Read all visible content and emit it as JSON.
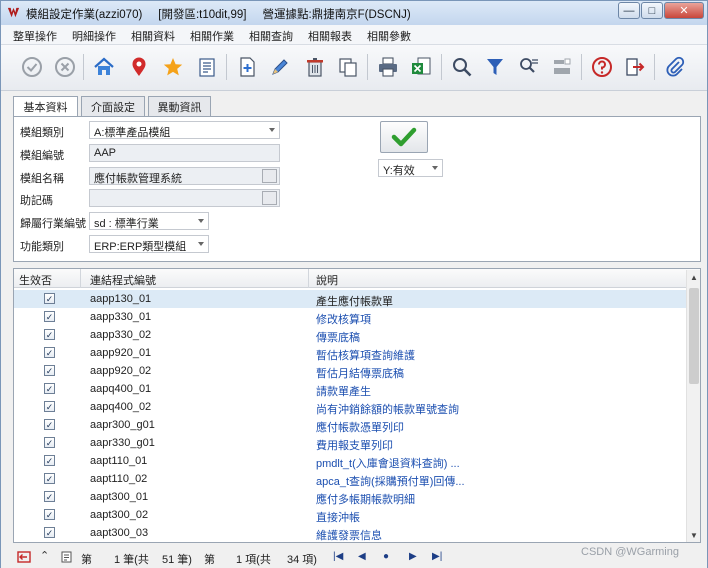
{
  "window": {
    "title": "模組設定作業(azzi070)     [開發區:t10dit,99]     營運據點:鼎捷南京F(DSCNJ)",
    "controls": [
      "—",
      "□",
      "✕"
    ]
  },
  "menu": [
    "整單操作",
    "明細操作",
    "相關資料",
    "相關作業",
    "相關查詢",
    "相關報表",
    "相關參數"
  ],
  "toolbar_icons": [
    "confirm-icon",
    "cancel-icon",
    "home-icon",
    "location-pin-icon",
    "star-icon",
    "list-icon",
    "add-icon",
    "edit-icon",
    "delete-icon",
    "copy-icon",
    "print-icon",
    "export-excel-icon",
    "search-icon",
    "filter-icon",
    "advanced-query-icon",
    "clear-icon",
    "help-icon",
    "exit-icon",
    "attachment-icon"
  ],
  "tabs": [
    "基本資料",
    "介面設定",
    "異動資訊"
  ],
  "form": {
    "category_label": "模組類別",
    "category_value": "A:標準產品模組",
    "module_no_label": "模組編號",
    "module_no_value": "AAP",
    "module_name_label": "模組名稱",
    "module_name_value": "應付帳款管理系統",
    "mnemonic_label": "助記碼",
    "mnemonic_value": "",
    "industry_label": "歸屬行業編號",
    "industry_value": "sd : 標準行業",
    "function_label": "功能類別",
    "function_value": "ERP:ERP類型模組",
    "status_value": "Y:有效"
  },
  "grid": {
    "columns": [
      "生效否",
      "連結程式編號",
      "說明"
    ],
    "rows": [
      {
        "program": "aapp130_01",
        "desc": "產生應付帳款單",
        "checked": true
      },
      {
        "program": "aapp330_01",
        "desc": "修改核算項",
        "checked": true
      },
      {
        "program": "aapp330_02",
        "desc": "傳票底稿",
        "checked": true
      },
      {
        "program": "aapp920_01",
        "desc": "暫估核算項查詢維護",
        "checked": true
      },
      {
        "program": "aapp920_02",
        "desc": "暫估月結傳票底稿",
        "checked": true
      },
      {
        "program": "aapq400_01",
        "desc": "請款單產生",
        "checked": true
      },
      {
        "program": "aapq400_02",
        "desc": "尚有沖銷餘額的帳款單號查詢",
        "checked": true
      },
      {
        "program": "aapr300_g01",
        "desc": "應付帳款憑單列印",
        "checked": true
      },
      {
        "program": "aapr330_g01",
        "desc": "費用報支單列印",
        "checked": true
      },
      {
        "program": "aapt110_01",
        "desc": "pmdlt_t(入庫會退資料查詢) ...",
        "checked": true
      },
      {
        "program": "aapt110_02",
        "desc": "apca_t查詢(採購預付單)回傳...",
        "checked": true
      },
      {
        "program": "aapt300_01",
        "desc": "應付多帳期帳款明細",
        "checked": true
      },
      {
        "program": "aapt300_02",
        "desc": "直接沖帳",
        "checked": true
      },
      {
        "program": "aapt300_03",
        "desc": "維護發票信息",
        "checked": true
      }
    ]
  },
  "status": {
    "p1": "第",
    "p2": "1 筆(共",
    "p3": "51 筆)",
    "p4": "第",
    "p5": "1 項(共",
    "p6": "34 項)"
  },
  "watermark": "CSDN @WGarming"
}
